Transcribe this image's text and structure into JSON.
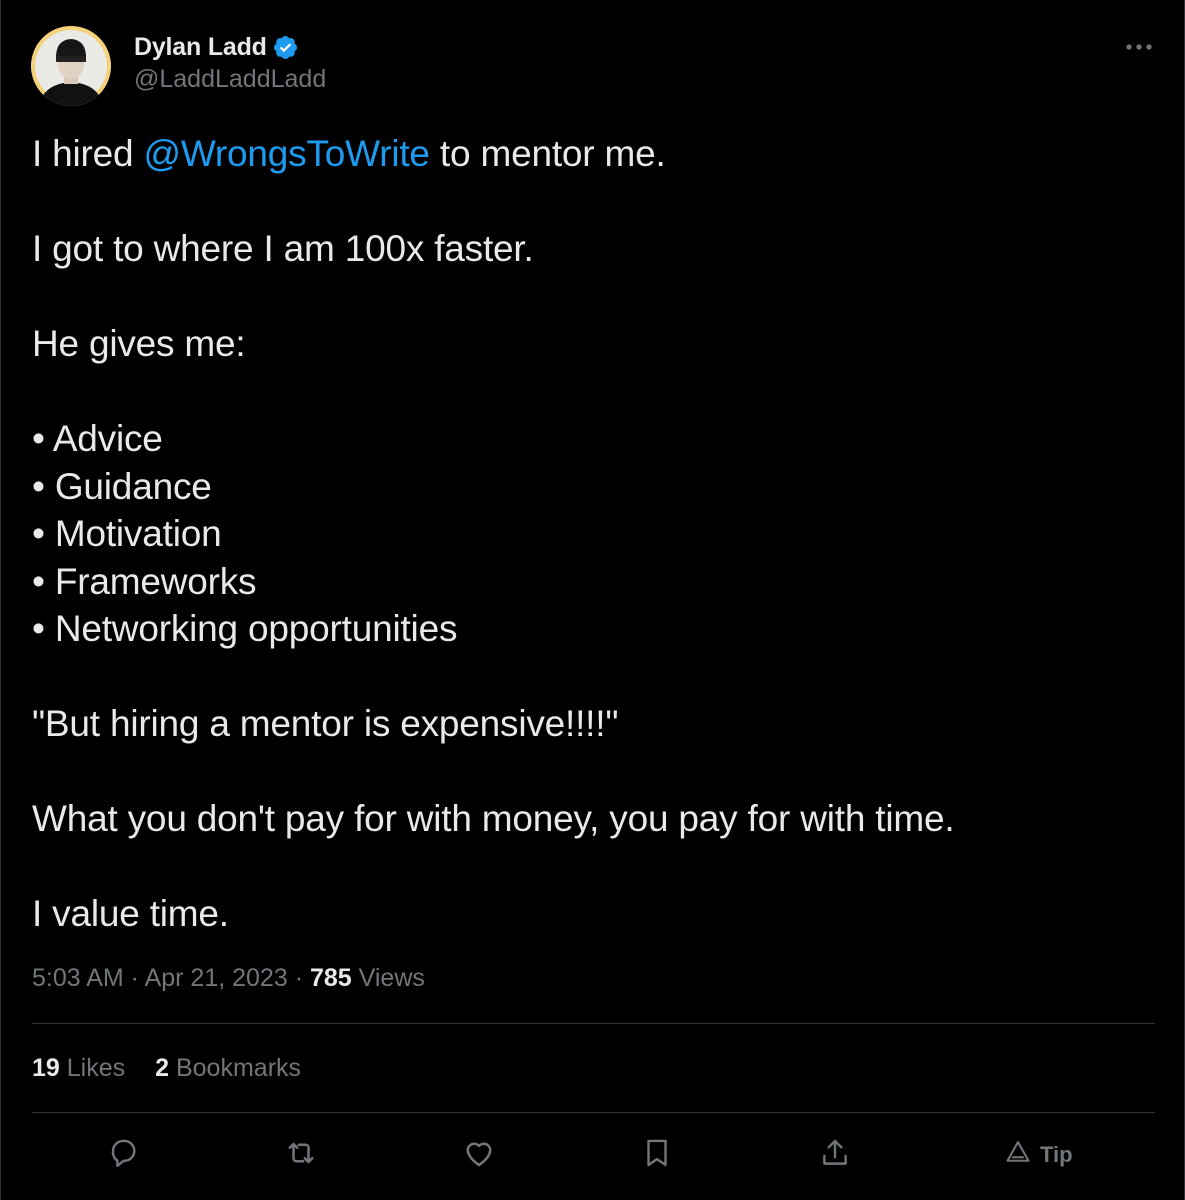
{
  "author": {
    "display_name": "Dylan Ladd",
    "handle": "@LaddLaddLadd",
    "verified": true
  },
  "tweet": {
    "line1_before": "I hired ",
    "line1_mention": "@WrongsToWrite",
    "line1_after": " to mentor me.",
    "line2": "I got to where I am 100x faster.",
    "line3": "He gives me:",
    "bullets": [
      "• Advice",
      "• Guidance",
      "• Motivation",
      "• Frameworks",
      "• Networking opportunities"
    ],
    "quote": "\"But hiring a mentor is expensive!!!!\"",
    "line5": "What you don't pay for with money, you pay for with time.",
    "line6": "I value time."
  },
  "meta": {
    "time": "5:03 AM",
    "sep1": " · ",
    "date": "Apr 21, 2023",
    "sep2": " · ",
    "views_count": "785",
    "views_label": " Views"
  },
  "stats": {
    "likes_count": "19",
    "likes_label": " Likes",
    "bookmarks_count": "2",
    "bookmarks_label": " Bookmarks"
  },
  "actions": {
    "tip_label": "Tip",
    "icons": [
      "reply-icon",
      "retweet-icon",
      "like-icon",
      "bookmark-icon",
      "share-icon",
      "tip-icon"
    ]
  },
  "colors": {
    "background": "#000000",
    "text": "#e7e9ea",
    "muted": "#71767b",
    "accent": "#1d9bf0",
    "border": "#2f3336"
  }
}
